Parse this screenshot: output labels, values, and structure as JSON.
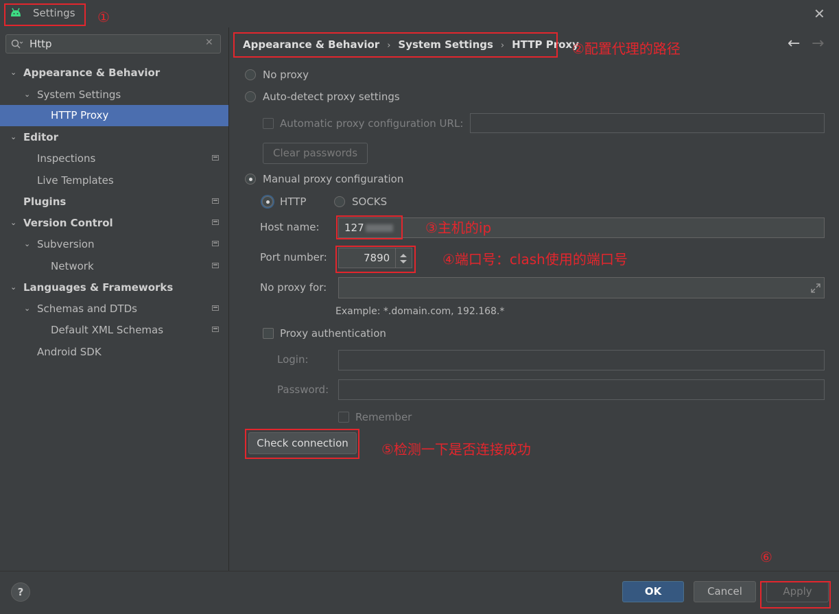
{
  "window": {
    "title": "Settings",
    "close_icon": "close-icon"
  },
  "search": {
    "value": "Http"
  },
  "tree": [
    {
      "label": "Appearance & Behavior",
      "bold": true
    },
    {
      "label": "System Settings"
    },
    {
      "label": "HTTP Proxy",
      "selected": true
    },
    {
      "label": "Editor",
      "bold": true
    },
    {
      "label": "Inspections"
    },
    {
      "label": "Live Templates"
    },
    {
      "label": "Plugins",
      "bold": true
    },
    {
      "label": "Version Control",
      "bold": true
    },
    {
      "label": "Subversion"
    },
    {
      "label": "Network"
    },
    {
      "label": "Languages & Frameworks",
      "bold": true
    },
    {
      "label": "Schemas and DTDs"
    },
    {
      "label": "Default XML Schemas"
    },
    {
      "label": "Android SDK"
    }
  ],
  "breadcrumb": [
    "Appearance & Behavior",
    "System Settings",
    "HTTP Proxy"
  ],
  "nav": {
    "back": "←",
    "forward": "→"
  },
  "proxy": {
    "no_proxy": "No proxy",
    "auto_detect": "Auto-detect proxy settings",
    "auto_config_url": "Automatic proxy configuration URL:",
    "clear_passwords": "Clear passwords",
    "manual": "Manual proxy configuration",
    "http": "HTTP",
    "socks": "SOCKS",
    "host_label": "Host name:",
    "host_value": "127",
    "port_label": "Port number:",
    "port_value": "7890",
    "no_proxy_for_label": "No proxy for:",
    "example": "Example: *.domain.com, 192.168.*",
    "proxy_auth": "Proxy authentication",
    "login_label": "Login:",
    "password_label": "Password:",
    "remember": "Remember",
    "check_connection": "Check connection"
  },
  "annotations": {
    "n1": "①",
    "n2": "②配置代理的路径",
    "n3": "③主机的ip",
    "n4": "④端口号：clash使用的端口号",
    "n5": "⑤检测一下是否连接成功",
    "n6": "⑥"
  },
  "footer": {
    "help": "?",
    "ok": "OK",
    "cancel": "Cancel",
    "apply": "Apply"
  },
  "colors": {
    "accent": "#4b6eaf",
    "annotation": "#e3262d",
    "android": "#3ddc84"
  }
}
